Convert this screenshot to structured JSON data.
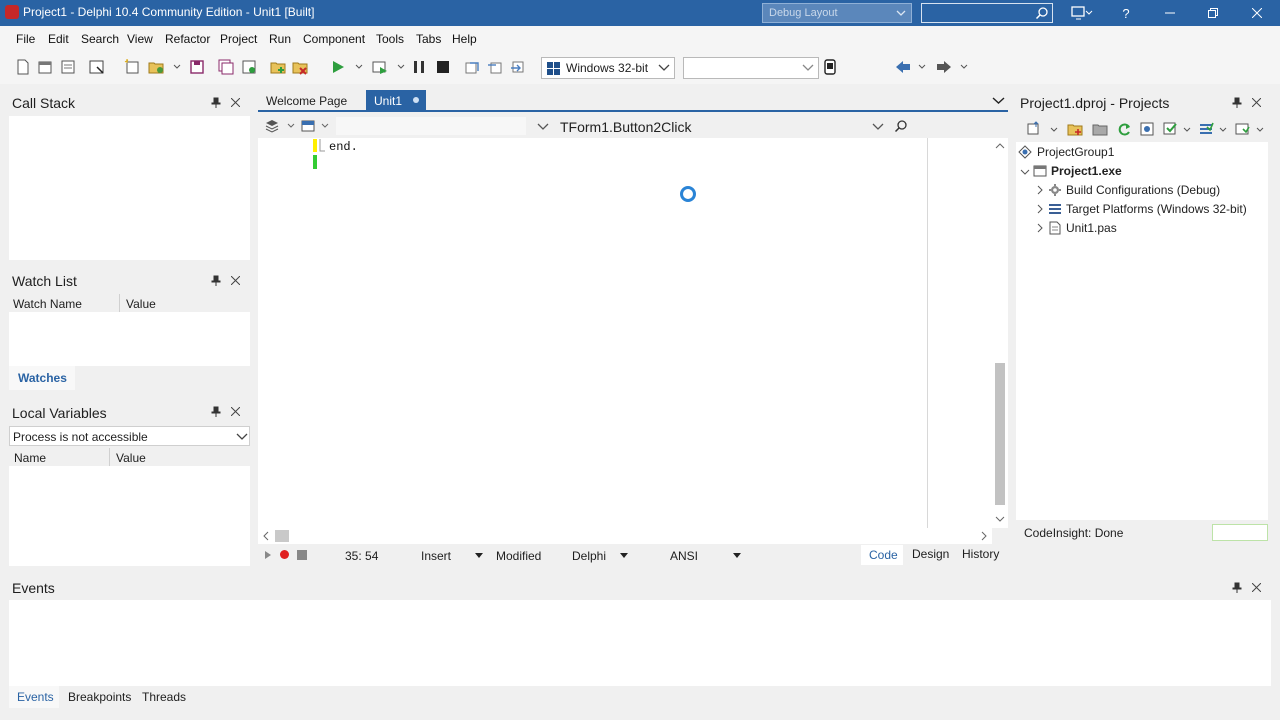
{
  "titlebar": {
    "title": "Project1 - Delphi 10.4 Community Edition - Unit1 [Built]",
    "layout": "Debug Layout",
    "help": "?"
  },
  "menu": [
    "File",
    "Edit",
    "Search",
    "View",
    "Refactor",
    "Project",
    "Run",
    "Component",
    "Tools",
    "Tabs",
    "Help"
  ],
  "toolbar": {
    "platform": "Windows 32-bit",
    "config": ""
  },
  "call_stack": {
    "title": "Call Stack"
  },
  "watch_list": {
    "title": "Watch List",
    "columns": [
      "Watch Name",
      "Value"
    ],
    "tab": "Watches"
  },
  "local_vars": {
    "title": "Local Variables",
    "process": "Process is not accessible",
    "columns": [
      "Name",
      "Value"
    ]
  },
  "editor": {
    "tabs": [
      "Welcome Page",
      "Unit1"
    ],
    "method": "TForm1.Button2Click",
    "code_line": "end.",
    "status": {
      "position": "35: 54",
      "mode": "Insert",
      "modified": "Modified",
      "language": "Delphi",
      "encoding": "ANSI",
      "views": [
        "Code",
        "Design",
        "History"
      ]
    }
  },
  "projects": {
    "title": "Project1.dproj - Projects",
    "group": "ProjectGroup1",
    "project": "Project1.exe",
    "items": [
      "Build Configurations (Debug)",
      "Target Platforms (Windows 32-bit)",
      "Unit1.pas"
    ],
    "status": "CodeInsight: Done"
  },
  "events": {
    "title": "Events",
    "tabs": [
      "Events",
      "Breakpoints",
      "Threads"
    ]
  },
  "colors": {
    "accent": "#2a63a4",
    "breakpoint": "#e02020",
    "run": "#2e9e3e"
  }
}
